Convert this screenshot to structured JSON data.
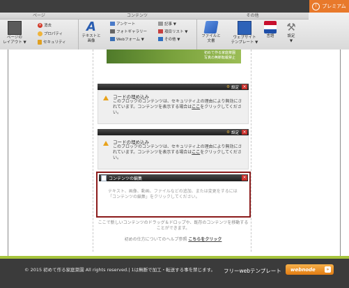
{
  "premium": {
    "label": "プレミアム",
    "icon": "premium-icon"
  },
  "ribbon": {
    "groups": {
      "page": "ページ",
      "contents": "コンテンツ",
      "other": "その他"
    },
    "layout_button": {
      "label": "ページの\nレイアウト ▼",
      "icon": "layout-icon"
    },
    "delete": "消去",
    "properties": "プロパティ",
    "security": "セキュリティ",
    "text_image": "テキストと\n画像",
    "survey": "アンケート",
    "photo_gallery": "フォトギャラリー",
    "web_form": "Webフォーム ▼",
    "article": "記事 ▼",
    "item_list": "項目リスト ▼",
    "other_menu": "その他 ▼",
    "files_docs": "ファイルと\n文書",
    "web_templates": "ウェブサイト\nテンプレート ▼",
    "language": "言語",
    "settings": "設定\n▼"
  },
  "thumb_caption": "初めて作る家庭菜園\n写真の無断転載禁止",
  "blocks": [
    {
      "settings_label": "設定",
      "title": "コードの埋め込み",
      "body_pre": "このブロックのコンテンツは、セキュリティ上の理由により無効にされています。コンテンツを表示する場合は",
      "link": "ここ",
      "body_post": "をクリックしてください。"
    },
    {
      "settings_label": "設定",
      "title": "コードの埋め込み",
      "body_pre": "このブロックのコンテンツは、セキュリティ上の理由により無効にされています。コンテンツを表示する場合は",
      "link": "ここ",
      "body_post": "をクリックしてください。"
    }
  ],
  "content_edit": {
    "title": "コンテンツの編集",
    "body": "テキスト、画像、動画、ファイルなどの追加、または変更をするには「コンテンツの編集」をクリックしてください。"
  },
  "drop_text": "ここで新しいコンテンツのドラッグ＆ドロップや、既存のコンテンツを移動することができます。",
  "help": {
    "pre": "初めの仕方についてのヘルプ参照",
    "link": "こちらをクリック"
  },
  "footer": {
    "copyright": "© 2015 初めて作る家庭菜園 All rights reserved.| 1は無断で加工・転送する事を禁じます。",
    "template_label": "フリーwebテンプレート",
    "webnode_label": "webnode"
  },
  "colors": {
    "accent": "#e8792b",
    "frame": "#8b1a1a",
    "green": "#a6c43c"
  }
}
